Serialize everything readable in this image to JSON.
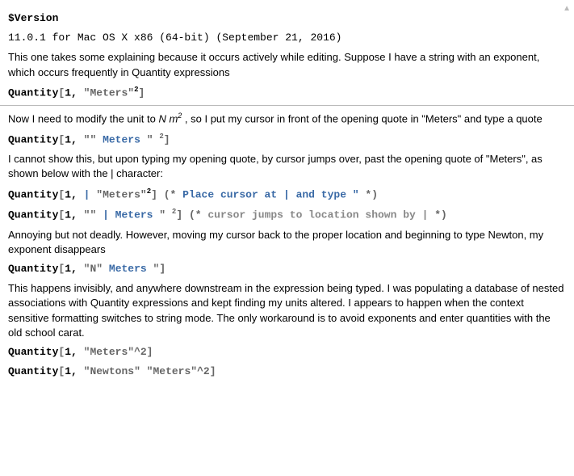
{
  "scroll_indicator": "▲",
  "in1": "$Version",
  "out1": "11.0.1 for Mac OS X x86 (64-bit) (September 21, 2016)",
  "para1": "This one takes some explaining because it occurs actively while editing.  Suppose I have a string with an exponent, which occurs frequently in Quantity expressions",
  "code1": {
    "fn": "Quantity",
    "open": "[",
    "arg1": "1",
    "sep": ", ",
    "q": "\"",
    "str": "Meters",
    "q2": "\"",
    "exp": "2",
    "close": "]"
  },
  "para2_a": "Now I need to modify the unit to ",
  "para2_unit": "N m",
  "para2_exp": "2",
  "para2_b": " , so I put my cursor in front of the opening quote in \"Meters\" and type a quote",
  "code2": {
    "fn": "Quantity",
    "open": "[",
    "arg1": "1",
    "sep": ", ",
    "q1": "\"\"",
    "sp": " ",
    "str": "Meters",
    "sp2": " ",
    "q2": "\"",
    "sp3": " ",
    "exp": "2",
    "close": "]"
  },
  "para3": "I cannot show this, but upon typing my opening quote, by cursor jumps over, past the opening quote of \"Meters\", as shown below with the | character:",
  "code3a": {
    "fn": "Quantity",
    "open": "[",
    "arg1": "1",
    "sep": ", ",
    "bar": "|",
    "q": " \"",
    "str": "Meters",
    "q2": "\"",
    "exp": "2",
    "close": "]",
    "comment_open": " (* ",
    "comment_text": "Place cursor at ",
    "comment_bar": "|",
    "comment_text2": " and type \" ",
    "comment_close": "*)"
  },
  "code3b": {
    "fn": "Quantity",
    "open": "[",
    "arg1": "1",
    "sep": ", ",
    "q1": "\"\"",
    "bar": " | ",
    "str": "Meters",
    "sp": " ",
    "q2": "\"",
    "sp2": " ",
    "exp": "2",
    "close": "]",
    "comment_open": " (* ",
    "comment_text": "cursor jumps to location shown by ",
    "comment_bar": "|",
    "comment_close": " *)"
  },
  "para4": "Annoying but not deadly.  However, moving my cursor back to the proper location and beginning to type Newton, my exponent disappears",
  "code4": {
    "fn": "Quantity",
    "open": "[",
    "arg1": "1",
    "sep": ", ",
    "q1": "\"",
    "n": "N",
    "q2": "\"",
    "sp": " ",
    "str": "Meters",
    "sp2": " ",
    "q3": "\"",
    "close": "]"
  },
  "para5": "This happens invisibly, and anywhere downstream in the expression being typed.  I was populating a database of nested associations with Quantity expressions and kept finding my units altered.  I appears to happen when the context sensitive formatting switches to string mode. The only workaround is to avoid exponents and enter quantities with the old school carat.",
  "code5": {
    "fn": "Quantity",
    "open": "[",
    "arg1": "1",
    "sep": ", ",
    "str": "\"Meters\"^2",
    "close": "]"
  },
  "code6": {
    "fn": "Quantity",
    "open": "[",
    "arg1": "1",
    "sep": ", ",
    "str": "\"Newtons\" \"Meters\"^2",
    "close": "]"
  }
}
